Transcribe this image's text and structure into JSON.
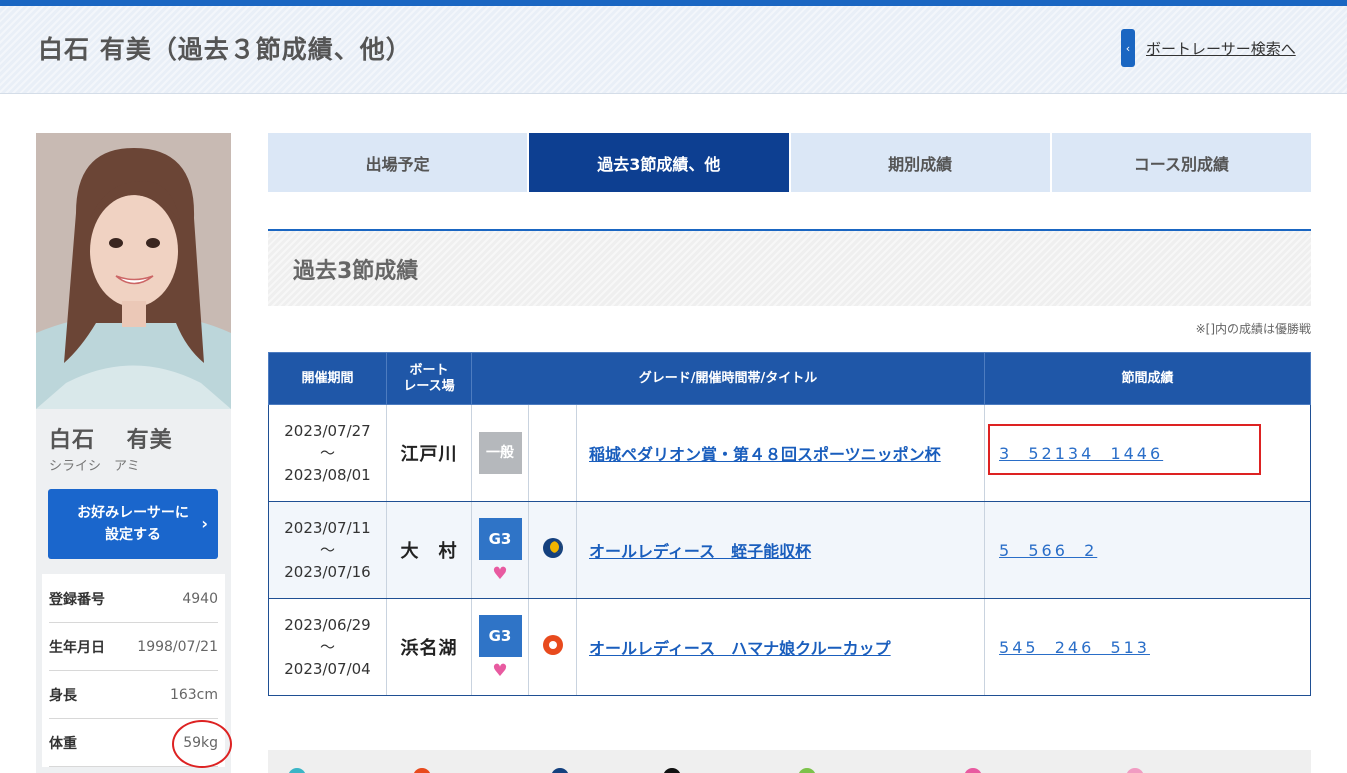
{
  "header": {
    "title": "白石 有美（過去３節成績、他）",
    "search_link": "ボートレーサー検索へ"
  },
  "profile": {
    "name": "白石　 有美",
    "kana": "シライシ　アミ",
    "fav_button": "お好みレーサーに設定する",
    "info": [
      {
        "label": "登録番号",
        "value": "4940"
      },
      {
        "label": "生年月日",
        "value": "1998/07/21"
      },
      {
        "label": "身長",
        "value": "163cm"
      },
      {
        "label": "体重",
        "value": "59kg"
      }
    ]
  },
  "tabs": [
    {
      "label": "出場予定",
      "active": false
    },
    {
      "label": "過去3節成績、他",
      "active": true
    },
    {
      "label": "期別成績",
      "active": false
    },
    {
      "label": "コース別成績",
      "active": false
    }
  ],
  "section": {
    "title": "過去3節成績",
    "note": "※[]内の成績は優勝戦"
  },
  "table": {
    "headers": {
      "period": "開催期間",
      "venue_line1": "ボート",
      "venue_line2": "レース場",
      "grade": "グレード/開催時間帯/タイトル",
      "results": "節間成績"
    },
    "rows": [
      {
        "from": "2023/07/27",
        "sep": "～",
        "to": "2023/08/01",
        "venue": "江戸川",
        "grade": "一般",
        "ladies": false,
        "time": "",
        "title": "稲城ペダリオン賞・第４８回スポーツニッポン杯",
        "results": "3  52134  1446"
      },
      {
        "from": "2023/07/11",
        "sep": "～",
        "to": "2023/07/16",
        "venue": "大　村",
        "grade": "G3",
        "ladies": true,
        "time": "night",
        "title": "オールレディース　蛭子能収杯",
        "results": "5  566  2"
      },
      {
        "from": "2023/06/29",
        "sep": "～",
        "to": "2023/07/04",
        "venue": "浜名湖",
        "grade": "G3",
        "ladies": true,
        "time": "day",
        "title": "オールレディース　ハマナ娘クルーカップ",
        "results": "545  246  513"
      }
    ]
  },
  "icons": {
    "back": "chevron-left-icon",
    "heart": "ladies-heart-icon",
    "night": "moon-icon",
    "day": "sun-icon"
  },
  "colors": {
    "accent": "#1a66c2",
    "tab_active": "#0d3f91",
    "table_header": "#1f57a8",
    "link": "#1a5ebd",
    "annotation_red": "#dd2222"
  }
}
